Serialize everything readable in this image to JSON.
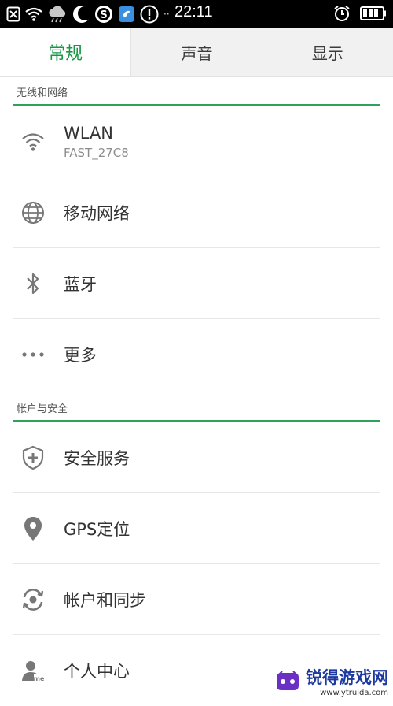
{
  "statusbar": {
    "time": "22:11",
    "dash": "··",
    "icons": [
      "close-box-icon",
      "wifi-icon",
      "cloud-rain-icon",
      "moon-icon",
      "s-icon",
      "shield-app-icon",
      "alert-icon",
      "alarm-icon",
      "battery-icon"
    ]
  },
  "tabs": [
    {
      "label": "常规",
      "active": true
    },
    {
      "label": "声音",
      "active": false
    },
    {
      "label": "显示",
      "active": false
    }
  ],
  "sections": [
    {
      "header": "无线和网络",
      "items": [
        {
          "icon": "wifi-icon",
          "title": "WLAN",
          "subtitle": "FAST_27C8"
        },
        {
          "icon": "globe-icon",
          "title": "移动网络"
        },
        {
          "icon": "bluetooth-icon",
          "title": "蓝牙"
        },
        {
          "icon": "more-dots-icon",
          "title": "更多"
        }
      ]
    },
    {
      "header": "帐户与安全",
      "items": [
        {
          "icon": "shield-plus-icon",
          "title": "安全服务"
        },
        {
          "icon": "location-pin-icon",
          "title": "GPS定位"
        },
        {
          "icon": "sync-icon",
          "title": "帐户和同步"
        },
        {
          "icon": "person-me-icon",
          "title": "个人中心"
        }
      ]
    }
  ],
  "watermark": {
    "name": "锐得游戏网",
    "url": "www.ytruida.com"
  },
  "colors": {
    "accent": "#199747",
    "divider": "#2ea25d"
  }
}
